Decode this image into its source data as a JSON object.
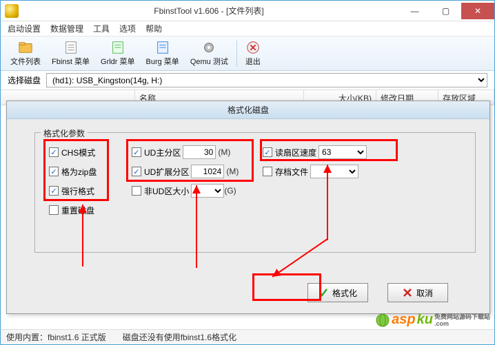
{
  "window": {
    "title": "FbinstTool v1.606 - [文件列表]",
    "min": "—",
    "max": "▢",
    "close": "✕"
  },
  "menubar": [
    "启动设置",
    "数据管理",
    "工具",
    "选项",
    "帮助"
  ],
  "toolbar": {
    "btn1": "文件列表",
    "btn2": "Fbinst 菜单",
    "btn3": "Grldr 菜单",
    "btn4": "Burg 菜单",
    "btn5": "Qemu 测试",
    "btn6": "退出"
  },
  "disk": {
    "label": "选择磁盘",
    "selected": "(hd1): USB_Kingston(14g, H:)"
  },
  "headers": {
    "name": "名称",
    "size": "大小(KB)",
    "date": "修改日期",
    "area": "存放区域"
  },
  "dialog": {
    "title": "格式化磁盘",
    "legend": "格式化参数",
    "chs": "CHS模式",
    "zip": "格为zip盘",
    "force": "强行格式",
    "reset": "重置磁盘",
    "udmain": "UD主分区",
    "udmain_val": "30",
    "udext": "UD扩展分区",
    "udext_val": "1024",
    "nonud": "非UD区大小",
    "nonud_val": "",
    "m": "(M)",
    "g": "(G)",
    "readspeed": "读扇区速度",
    "readspeed_val": "63",
    "archive": "存档文件",
    "archive_val": "",
    "ok": "格式化",
    "cancel": "取消"
  },
  "status": {
    "left": "使用内置：fbinst1.6 正式版",
    "right": "磁盘还没有使用fbinst1.6格式化"
  },
  "watermark": {
    "a": "asp",
    "b": "ku",
    "c": "免费网站源码下载站",
    "d": ".com"
  }
}
